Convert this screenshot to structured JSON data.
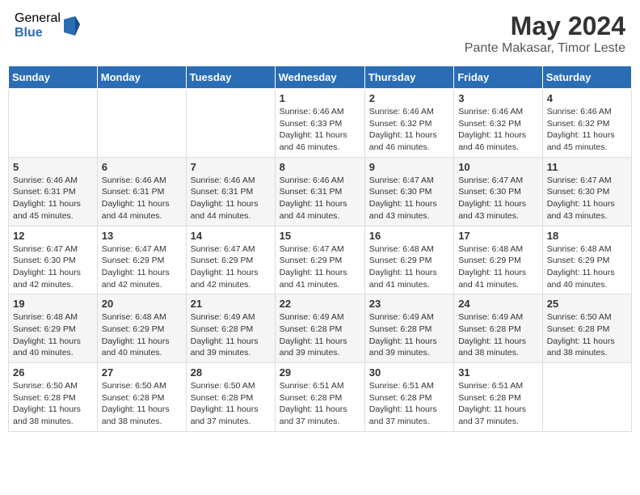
{
  "header": {
    "logo_general": "General",
    "logo_blue": "Blue",
    "month_year": "May 2024",
    "location": "Pante Makasar, Timor Leste"
  },
  "days_of_week": [
    "Sunday",
    "Monday",
    "Tuesday",
    "Wednesday",
    "Thursday",
    "Friday",
    "Saturday"
  ],
  "weeks": [
    [
      {
        "day": "",
        "info": ""
      },
      {
        "day": "",
        "info": ""
      },
      {
        "day": "",
        "info": ""
      },
      {
        "day": "1",
        "info": "Sunrise: 6:46 AM\nSunset: 6:33 PM\nDaylight: 11 hours and 46 minutes."
      },
      {
        "day": "2",
        "info": "Sunrise: 6:46 AM\nSunset: 6:32 PM\nDaylight: 11 hours and 46 minutes."
      },
      {
        "day": "3",
        "info": "Sunrise: 6:46 AM\nSunset: 6:32 PM\nDaylight: 11 hours and 46 minutes."
      },
      {
        "day": "4",
        "info": "Sunrise: 6:46 AM\nSunset: 6:32 PM\nDaylight: 11 hours and 45 minutes."
      }
    ],
    [
      {
        "day": "5",
        "info": "Sunrise: 6:46 AM\nSunset: 6:31 PM\nDaylight: 11 hours and 45 minutes."
      },
      {
        "day": "6",
        "info": "Sunrise: 6:46 AM\nSunset: 6:31 PM\nDaylight: 11 hours and 44 minutes."
      },
      {
        "day": "7",
        "info": "Sunrise: 6:46 AM\nSunset: 6:31 PM\nDaylight: 11 hours and 44 minutes."
      },
      {
        "day": "8",
        "info": "Sunrise: 6:46 AM\nSunset: 6:31 PM\nDaylight: 11 hours and 44 minutes."
      },
      {
        "day": "9",
        "info": "Sunrise: 6:47 AM\nSunset: 6:30 PM\nDaylight: 11 hours and 43 minutes."
      },
      {
        "day": "10",
        "info": "Sunrise: 6:47 AM\nSunset: 6:30 PM\nDaylight: 11 hours and 43 minutes."
      },
      {
        "day": "11",
        "info": "Sunrise: 6:47 AM\nSunset: 6:30 PM\nDaylight: 11 hours and 43 minutes."
      }
    ],
    [
      {
        "day": "12",
        "info": "Sunrise: 6:47 AM\nSunset: 6:30 PM\nDaylight: 11 hours and 42 minutes."
      },
      {
        "day": "13",
        "info": "Sunrise: 6:47 AM\nSunset: 6:29 PM\nDaylight: 11 hours and 42 minutes."
      },
      {
        "day": "14",
        "info": "Sunrise: 6:47 AM\nSunset: 6:29 PM\nDaylight: 11 hours and 42 minutes."
      },
      {
        "day": "15",
        "info": "Sunrise: 6:47 AM\nSunset: 6:29 PM\nDaylight: 11 hours and 41 minutes."
      },
      {
        "day": "16",
        "info": "Sunrise: 6:48 AM\nSunset: 6:29 PM\nDaylight: 11 hours and 41 minutes."
      },
      {
        "day": "17",
        "info": "Sunrise: 6:48 AM\nSunset: 6:29 PM\nDaylight: 11 hours and 41 minutes."
      },
      {
        "day": "18",
        "info": "Sunrise: 6:48 AM\nSunset: 6:29 PM\nDaylight: 11 hours and 40 minutes."
      }
    ],
    [
      {
        "day": "19",
        "info": "Sunrise: 6:48 AM\nSunset: 6:29 PM\nDaylight: 11 hours and 40 minutes."
      },
      {
        "day": "20",
        "info": "Sunrise: 6:48 AM\nSunset: 6:29 PM\nDaylight: 11 hours and 40 minutes."
      },
      {
        "day": "21",
        "info": "Sunrise: 6:49 AM\nSunset: 6:28 PM\nDaylight: 11 hours and 39 minutes."
      },
      {
        "day": "22",
        "info": "Sunrise: 6:49 AM\nSunset: 6:28 PM\nDaylight: 11 hours and 39 minutes."
      },
      {
        "day": "23",
        "info": "Sunrise: 6:49 AM\nSunset: 6:28 PM\nDaylight: 11 hours and 39 minutes."
      },
      {
        "day": "24",
        "info": "Sunrise: 6:49 AM\nSunset: 6:28 PM\nDaylight: 11 hours and 38 minutes."
      },
      {
        "day": "25",
        "info": "Sunrise: 6:50 AM\nSunset: 6:28 PM\nDaylight: 11 hours and 38 minutes."
      }
    ],
    [
      {
        "day": "26",
        "info": "Sunrise: 6:50 AM\nSunset: 6:28 PM\nDaylight: 11 hours and 38 minutes."
      },
      {
        "day": "27",
        "info": "Sunrise: 6:50 AM\nSunset: 6:28 PM\nDaylight: 11 hours and 38 minutes."
      },
      {
        "day": "28",
        "info": "Sunrise: 6:50 AM\nSunset: 6:28 PM\nDaylight: 11 hours and 37 minutes."
      },
      {
        "day": "29",
        "info": "Sunrise: 6:51 AM\nSunset: 6:28 PM\nDaylight: 11 hours and 37 minutes."
      },
      {
        "day": "30",
        "info": "Sunrise: 6:51 AM\nSunset: 6:28 PM\nDaylight: 11 hours and 37 minutes."
      },
      {
        "day": "31",
        "info": "Sunrise: 6:51 AM\nSunset: 6:28 PM\nDaylight: 11 hours and 37 minutes."
      },
      {
        "day": "",
        "info": ""
      }
    ]
  ]
}
